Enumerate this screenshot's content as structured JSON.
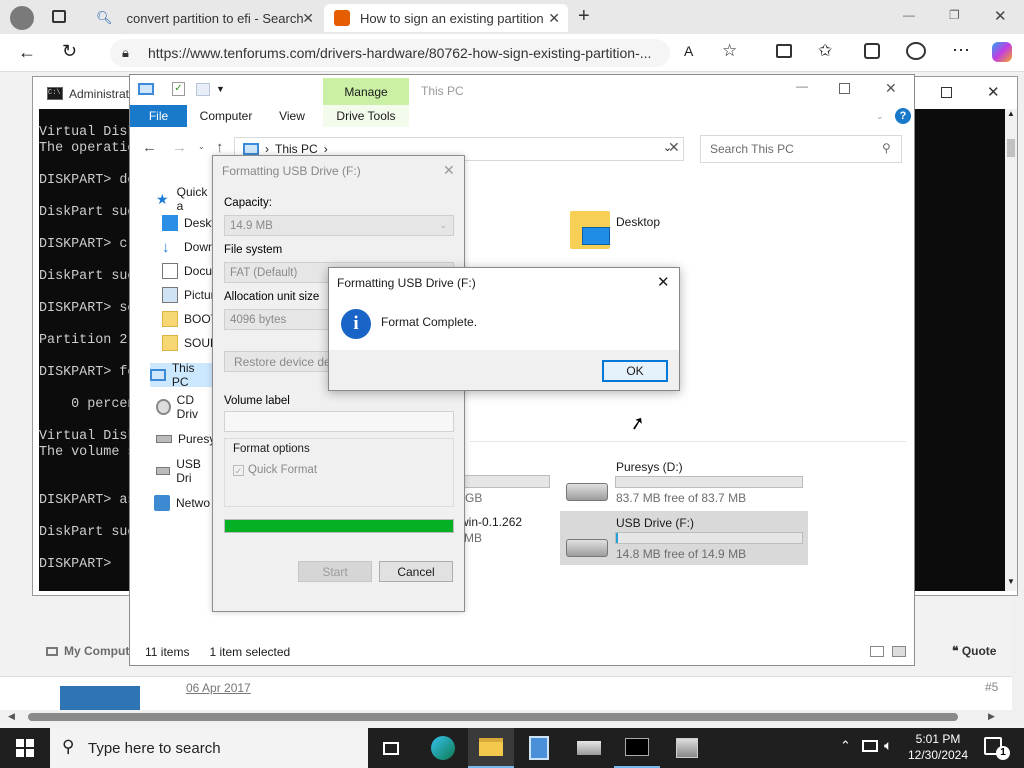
{
  "browser": {
    "tabs": [
      {
        "title": "convert partition to efi - Search",
        "active": false
      },
      {
        "title": "How to sign an existing partition",
        "active": true
      }
    ],
    "url": "https://www.tenforums.com/drivers-hardware/80762-how-sign-existing-partition-..."
  },
  "cmd": {
    "title": "Administrat",
    "lines": [
      "Virtual Disk",
      "The operatio",
      "",
      "DISKPART> de",
      "",
      "DiskPart suc",
      "",
      "DISKPART> cr",
      "",
      "DiskPart suc",
      "",
      "DISKPART> se",
      "",
      "Partition 2",
      "",
      "DISKPART> fo",
      "",
      "    0 percen",
      "",
      "Virtual Disk",
      "The volume s",
      "",
      "",
      "DISKPART> as",
      "",
      "DiskPart suc",
      "",
      "DISKPART> "
    ]
  },
  "explorer": {
    "title": "This PC",
    "manage_tab": "Manage",
    "ribbon_tabs": [
      "File",
      "Computer",
      "View",
      "Drive Tools"
    ],
    "path": "This PC",
    "search_placeholder": "Search This PC",
    "nav_items": [
      "Quick a",
      "Deskt",
      "Down",
      "Docu",
      "Pictur",
      "BOOT",
      "SOUR",
      "This PC",
      "CD Driv",
      "Puresys",
      "USB Dri",
      "Netwo"
    ],
    "folder": {
      "name": "Desktop"
    },
    "drives": [
      {
        "name": "Puresys (D:)",
        "free": "83.7 MB free of 83.7 MB",
        "fill": 0.0
      },
      {
        "name": "USB Drive (F:)",
        "free": "14.8 MB free of 14.9 MB",
        "fill": 0.01
      }
    ],
    "partial_drive": {
      "size_tail": "GB",
      "name_tail": "win-0.1.262",
      "size_tail2": "MB"
    },
    "status": {
      "items": "11 items",
      "selected": "1 item selected"
    }
  },
  "format_dialog": {
    "title": "Formatting USB Drive (F:)",
    "capacity_label": "Capacity:",
    "capacity": "14.9 MB",
    "fs_label": "File system",
    "fs": "FAT (Default)",
    "alloc_label": "Allocation unit size",
    "alloc": "4096 bytes",
    "restore": "Restore device defa",
    "volume_label": "Volume label",
    "options_label": "Format options",
    "quick_format": "Quick Format",
    "progress": 1.0,
    "start": "Start",
    "cancel": "Cancel"
  },
  "message": {
    "title": "Formatting USB Drive (F:)",
    "text": "Format Complete.",
    "ok": "OK"
  },
  "forum": {
    "my_computer": "My Compute",
    "quote": "Quote",
    "date": "06 Apr 2017",
    "post_no": "#5"
  },
  "taskbar": {
    "search_placeholder": "Type here to search",
    "time": "5:01 PM",
    "date": "12/30/2024",
    "notification_count": "1"
  },
  "colors": {
    "accent": "#0078d7",
    "progress": "#06b025",
    "manage_tab": "#c9f0a4",
    "taskbar": "#1f1f1f"
  }
}
